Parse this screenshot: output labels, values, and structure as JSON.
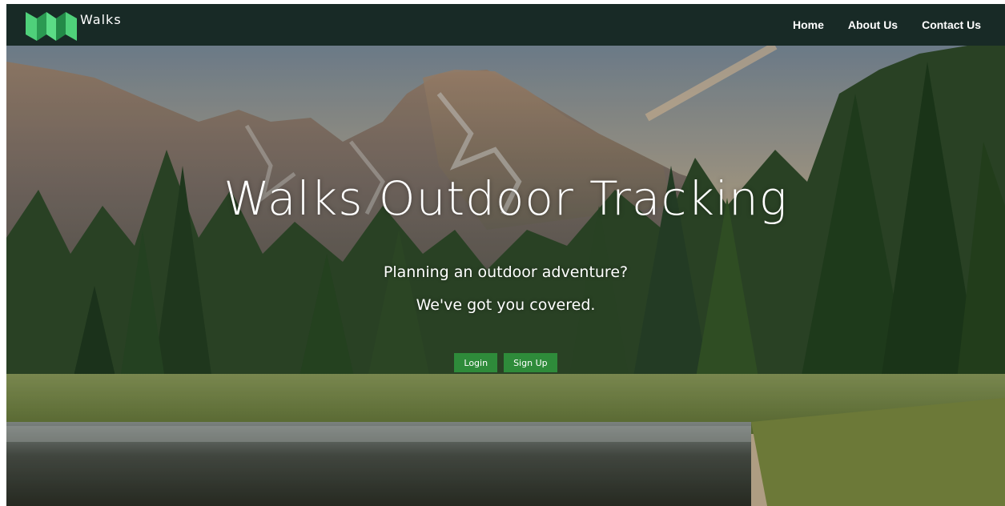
{
  "navbar": {
    "brand": "Walks",
    "logo_icon": "folded-map-logo",
    "links": [
      {
        "label": "Home"
      },
      {
        "label": "About Us"
      },
      {
        "label": "Contact Us"
      }
    ]
  },
  "hero": {
    "title": "Walks Outdoor Tracking",
    "subtitle_1": "Planning an outdoor adventure?",
    "subtitle_2": "We've got you covered.",
    "login_label": "Login",
    "signup_label": "Sign Up",
    "background": "mountain-forest-lake-photo"
  },
  "colors": {
    "navbar": "#182a26",
    "button": "#2e8b3a",
    "logo_light": "#4fd07a",
    "logo_dark": "#2b9a52"
  }
}
